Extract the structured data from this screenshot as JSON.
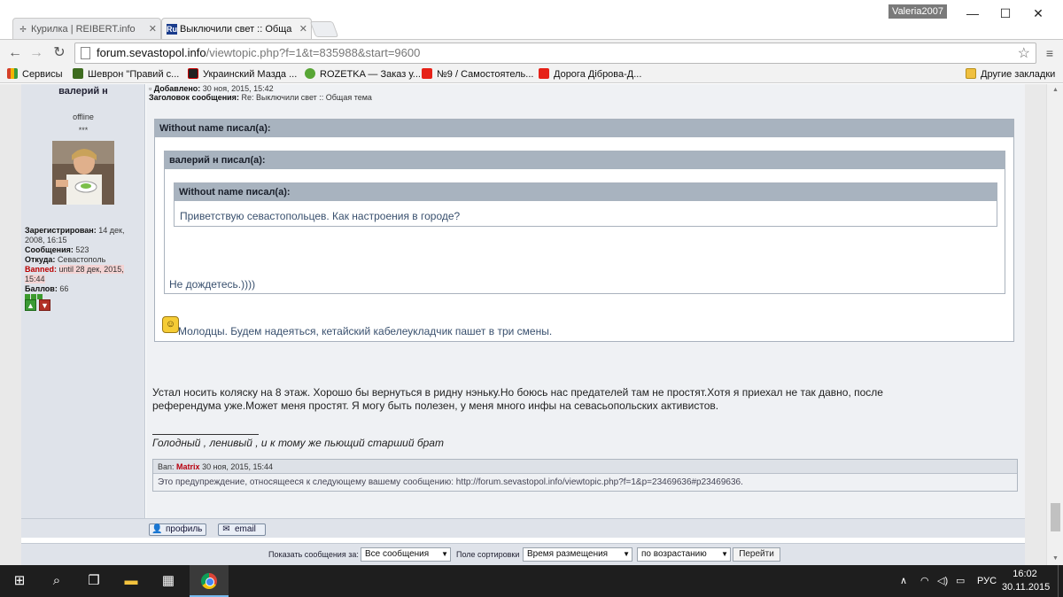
{
  "browser": {
    "tabs": [
      {
        "label": "Курилка | REIBERT.info",
        "favicon": "✢"
      },
      {
        "label": "Выключили свет :: Обща",
        "favicon": "Ru"
      }
    ],
    "user_badge": "Valeria2007",
    "window_controls": {
      "minimize": "—",
      "maximize": "☐",
      "close": "✕"
    },
    "url": {
      "host": "forum.sevastopol.info",
      "path": "/viewtopic.php?f=1&t=835988&start=9600"
    },
    "bookmarks": [
      {
        "label": "Сервисы",
        "color": "#d54027"
      },
      {
        "label": "Шеврон \"Правий с...",
        "color": "#3d6b1f"
      },
      {
        "label": "Украинский Мазда ...",
        "color": "#222222"
      },
      {
        "label": "ROZETKA — Заказ у...",
        "color": "#58a635"
      },
      {
        "label": "№9 / Самостоятель...",
        "color": "#e62117"
      },
      {
        "label": "Дорога Діброва-Д...",
        "color": "#e62117"
      }
    ],
    "other_bookmarks": "Другие закладки"
  },
  "post": {
    "author": "валерий н",
    "status": "offline",
    "rank": "***",
    "meta": {
      "added_label": "Добавлено:",
      "added_value": "30 ноя, 2015, 15:42",
      "subject_label": "Заголовок сообщения:",
      "subject_value": "Re: Выключили свет :: Общая тема"
    },
    "profile": {
      "registered_label": "Зарегистрирован:",
      "registered_value": "14 дек, 2008, 16:15",
      "messages_label": "Сообщения:",
      "messages_value": "523",
      "from_label": "Откуда:",
      "from_value": "Севастополь",
      "banned_label": "Banned:",
      "banned_value": "until 28 дек, 2015, 15:44",
      "points_label": "Баллов:",
      "points_value": "66"
    },
    "quotes": {
      "outer_head": "Without name писал(а):",
      "mid_head": "валерий н писал(а):",
      "inner_head": "Without name писал(а):",
      "inner_text": "Приветствую севастопольцев. Как настроения в городе?",
      "mid_text": "Не дождетесь.))))",
      "outer_text": "Молодцы. Будем надеяться, кетайский кабелеукладчик пашет в три смены."
    },
    "body_line1": "Устал носить коляску на 8 этаж. Хорошо бы вернуться в ридну нэньку.Но боюсь нас предателей там не простят.Хотя я приехал не так давно, после",
    "body_line2": "референдума уже.Может меня простят. Я могу быть полезен, у меня много инфы на севасьопольских активистов.",
    "signature": "Голодный , ленивый , и к тому же пьющий старший брат",
    "ban": {
      "prefix": "Ban:",
      "moderator": "Matrix",
      "date": "30 ноя, 2015, 15:44",
      "text": "Это предупреждение, относящееся к следующему вашему сообщению: http://forum.sevastopol.info/viewtopic.php?f=1&p=23469636#p23469636."
    },
    "buttons": {
      "profile": "профиль",
      "email": "email"
    }
  },
  "sort": {
    "show_label": "Показать сообщения за:",
    "show_value": "Все сообщения",
    "sort_label": "Поле сортировки",
    "sort_value": "Время размещения",
    "order_value": "по возрастанию",
    "go": "Перейти"
  },
  "taskbar": {
    "language": "РУС",
    "time": "16:02",
    "date": "30.11.2015"
  }
}
